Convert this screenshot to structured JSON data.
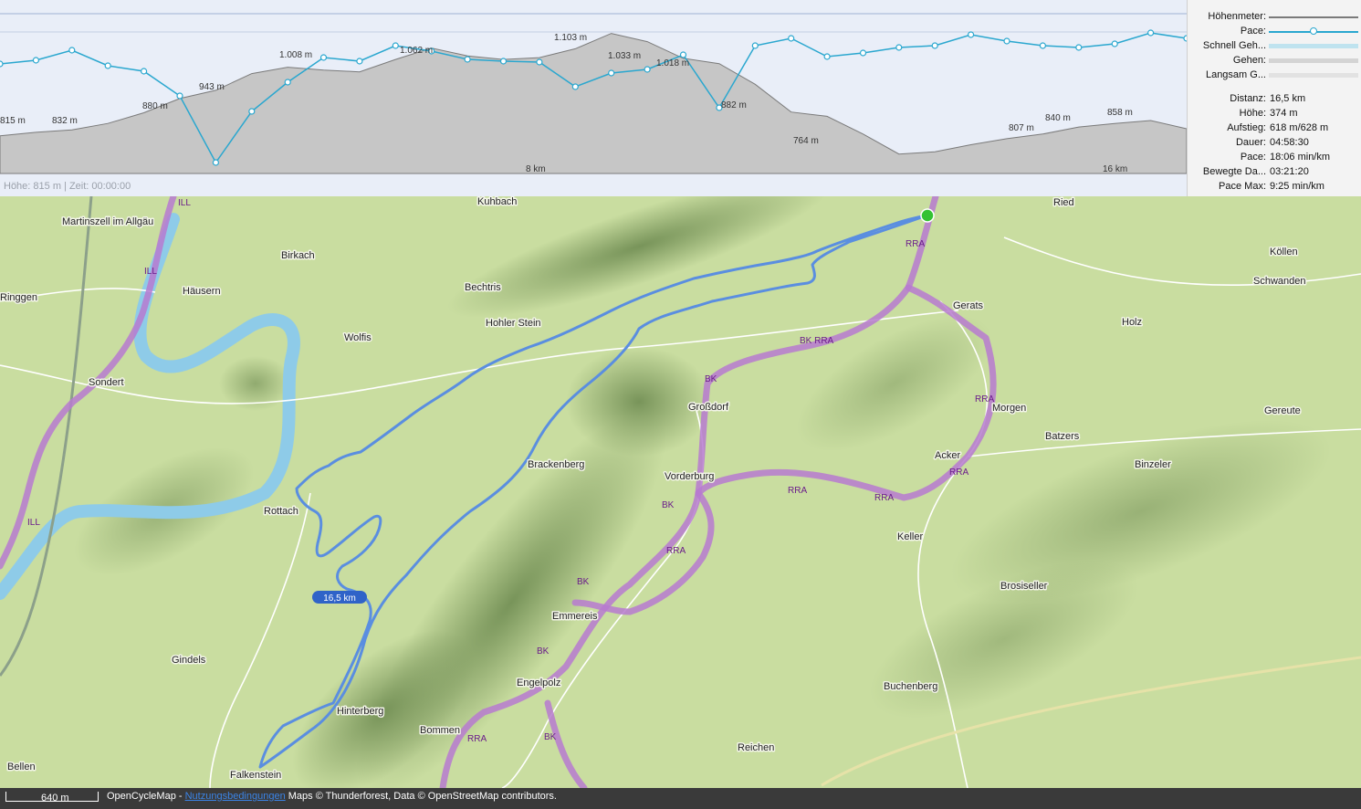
{
  "chart": {
    "elevation_labels": [
      "815 m",
      "832 m",
      "880 m",
      "943 m",
      "1.008 m",
      "1.062 m",
      "1.103 m",
      "1.033 m",
      "1.018 m",
      "882 m",
      "764 m",
      "807 m",
      "840 m",
      "858 m"
    ],
    "distance_ticks": [
      "8 km",
      "16 km"
    ],
    "status": "Höhe: 815 m | Zeit: 00:00:00"
  },
  "chart_data": {
    "type": "area",
    "xlabel": "",
    "ylabel": "",
    "x": [
      0,
      0.5,
      1,
      1.5,
      2,
      2.5,
      3,
      3.5,
      4,
      4.5,
      5,
      5.5,
      6,
      6.5,
      7,
      7.5,
      8,
      8.5,
      9,
      9.5,
      10,
      10.5,
      11,
      11.5,
      12,
      12.5,
      13,
      13.5,
      14,
      14.5,
      15,
      15.5,
      16,
      16.5
    ],
    "series": [
      {
        "name": "Höhenmeter",
        "values": [
          815,
          825,
          832,
          850,
          880,
          920,
          943,
          990,
          1008,
          1000,
          995,
          1030,
          1062,
          1040,
          1030,
          1035,
          1060,
          1103,
          1080,
          1033,
          1018,
          960,
          882,
          870,
          820,
          764,
          770,
          790,
          807,
          820,
          840,
          850,
          858,
          835
        ]
      }
    ]
  },
  "legend": {
    "items": [
      {
        "label": "Höhenmeter:",
        "color": "#7a7a7a"
      },
      {
        "label": "Pace:",
        "color": "#2aa7cf"
      },
      {
        "label": "Schnell Geh...",
        "color": "#bfe3ef"
      },
      {
        "label": "Gehen:",
        "color": "#d4d4d4"
      },
      {
        "label": "Langsam G...",
        "color": "#e2e2e2"
      }
    ],
    "stats": [
      {
        "label": "Distanz:",
        "value": "16,5 km"
      },
      {
        "label": "Höhe:",
        "value": "374 m"
      },
      {
        "label": "Aufstieg:",
        "value": "618 m/628 m"
      },
      {
        "label": "Dauer:",
        "value": "04:58:30"
      },
      {
        "label": "Pace:",
        "value": "18:06 min/km"
      },
      {
        "label": "Bewegte Da...",
        "value": "03:21:20"
      },
      {
        "label": "Pace Max:",
        "value": "9:25 min/km"
      }
    ]
  },
  "map": {
    "places": [
      "Kuhbach",
      "Martinszell im Allgäu",
      "Birkach",
      "Ringgen",
      "Häusern",
      "Bechtris",
      "Hohler Stein",
      "Wolfis",
      "Sondert",
      "Ried",
      "Köllen",
      "Schwanden",
      "Gerats",
      "Holz",
      "Großdorf",
      "Morgen",
      "Gereute",
      "Batzers",
      "Brackenberg",
      "Vorderburg",
      "Acker",
      "Binzeler",
      "Rottach",
      "Keller",
      "Brosisellег",
      "Emmereis",
      "Gindels",
      "Buchenberg",
      "Engelpolz",
      "Hinterberg",
      "Bommen",
      "Reichen",
      "Bellen",
      "Falkenstein"
    ],
    "route_labels": [
      "ILL",
      "ILL",
      "ILL",
      "RRA",
      "BK RRA",
      "BK",
      "RRA",
      "RRA",
      "RRA",
      "RRA",
      "BK",
      "RRA",
      "BK",
      "BK",
      "RRA",
      "BK"
    ],
    "track_badge": "16,5 km"
  },
  "footer": {
    "scale": "640 m",
    "provider": "OpenCycleMap -",
    "terms_link": "Nutzungsbedingungen",
    "credits": "Maps © Thunderforest, Data © OpenStreetMap contributors."
  },
  "colors": {
    "elevation_fill": "#c6c6c6",
    "pace_line": "#2aa7cf",
    "track": "#5a8ee0",
    "cycle_route": "#b77ad0",
    "river": "#8ecbe8",
    "start_marker": "#33c233"
  }
}
